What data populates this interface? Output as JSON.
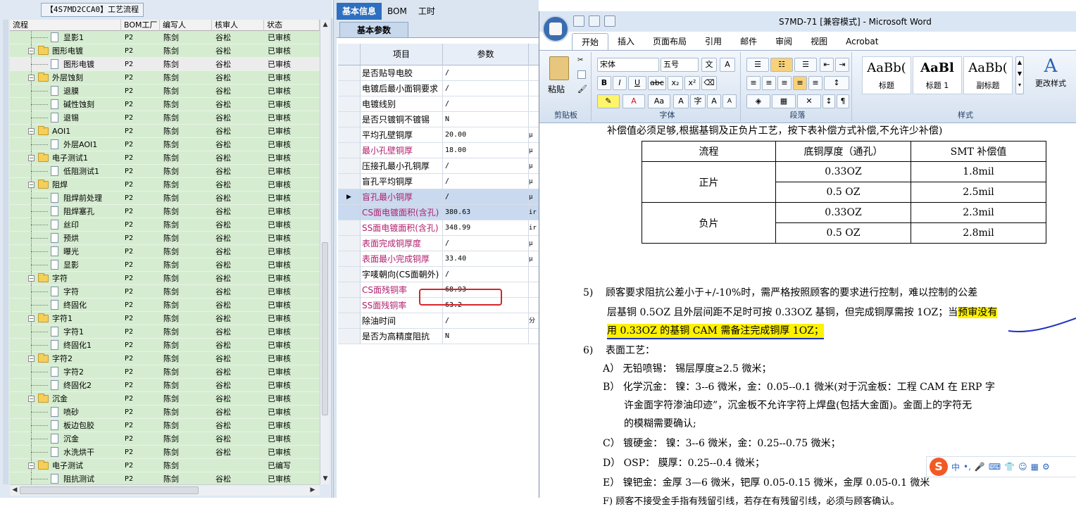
{
  "left_panel": {
    "title": "【4S7MD2CCA0】工艺流程",
    "columns": [
      "流程",
      "BOM工厂",
      "编写人",
      "核审人",
      "状态"
    ],
    "rows": [
      {
        "name": "显影1",
        "type": "doc",
        "level": 2,
        "bom": "P2",
        "writer": "陈剑",
        "reviewer": "谷松",
        "status": "已审核"
      },
      {
        "name": "图形电镀",
        "type": "folder",
        "level": 1,
        "bom": "P2",
        "writer": "陈剑",
        "reviewer": "谷松",
        "status": "已审核"
      },
      {
        "name": "图形电镀",
        "type": "doc",
        "level": 2,
        "bom": "P2",
        "writer": "陈剑",
        "reviewer": "谷松",
        "status": "已审核",
        "selected": true
      },
      {
        "name": "外层蚀刻",
        "type": "folder",
        "level": 1,
        "bom": "P2",
        "writer": "陈剑",
        "reviewer": "谷松",
        "status": "已审核"
      },
      {
        "name": "退膜",
        "type": "doc",
        "level": 2,
        "bom": "P2",
        "writer": "陈剑",
        "reviewer": "谷松",
        "status": "已审核"
      },
      {
        "name": "碱性蚀刻",
        "type": "doc",
        "level": 2,
        "bom": "P2",
        "writer": "陈剑",
        "reviewer": "谷松",
        "status": "已审核"
      },
      {
        "name": "退锡",
        "type": "doc",
        "level": 2,
        "bom": "P2",
        "writer": "陈剑",
        "reviewer": "谷松",
        "status": "已审核"
      },
      {
        "name": "AOI1",
        "type": "folder",
        "level": 1,
        "bom": "P2",
        "writer": "陈剑",
        "reviewer": "谷松",
        "status": "已审核"
      },
      {
        "name": "外层AOI1",
        "type": "doc",
        "level": 2,
        "bom": "P2",
        "writer": "陈剑",
        "reviewer": "谷松",
        "status": "已审核"
      },
      {
        "name": "电子测试1",
        "type": "folder",
        "level": 1,
        "bom": "P2",
        "writer": "陈剑",
        "reviewer": "谷松",
        "status": "已审核"
      },
      {
        "name": "低阻测试1",
        "type": "doc",
        "level": 2,
        "bom": "P2",
        "writer": "陈剑",
        "reviewer": "谷松",
        "status": "已审核"
      },
      {
        "name": "阻焊",
        "type": "folder",
        "level": 1,
        "bom": "P2",
        "writer": "陈剑",
        "reviewer": "谷松",
        "status": "已审核"
      },
      {
        "name": "阻焊前处理",
        "type": "doc",
        "level": 2,
        "bom": "P2",
        "writer": "陈剑",
        "reviewer": "谷松",
        "status": "已审核"
      },
      {
        "name": "阻焊塞孔",
        "type": "doc",
        "level": 2,
        "bom": "P2",
        "writer": "陈剑",
        "reviewer": "谷松",
        "status": "已审核"
      },
      {
        "name": "丝印",
        "type": "doc",
        "level": 2,
        "bom": "P2",
        "writer": "陈剑",
        "reviewer": "谷松",
        "status": "已审核"
      },
      {
        "name": "预烘",
        "type": "doc",
        "level": 2,
        "bom": "P2",
        "writer": "陈剑",
        "reviewer": "谷松",
        "status": "已审核"
      },
      {
        "name": "曝光",
        "type": "doc",
        "level": 2,
        "bom": "P2",
        "writer": "陈剑",
        "reviewer": "谷松",
        "status": "已审核"
      },
      {
        "name": "显影",
        "type": "doc",
        "level": 2,
        "bom": "P2",
        "writer": "陈剑",
        "reviewer": "谷松",
        "status": "已审核"
      },
      {
        "name": "字符",
        "type": "folder",
        "level": 1,
        "bom": "P2",
        "writer": "陈剑",
        "reviewer": "谷松",
        "status": "已审核"
      },
      {
        "name": "字符",
        "type": "doc",
        "level": 2,
        "bom": "P2",
        "writer": "陈剑",
        "reviewer": "谷松",
        "status": "已审核"
      },
      {
        "name": "终固化",
        "type": "doc",
        "level": 2,
        "bom": "P2",
        "writer": "陈剑",
        "reviewer": "谷松",
        "status": "已审核"
      },
      {
        "name": "字符1",
        "type": "folder",
        "level": 1,
        "bom": "P2",
        "writer": "陈剑",
        "reviewer": "谷松",
        "status": "已审核"
      },
      {
        "name": "字符1",
        "type": "doc",
        "level": 2,
        "bom": "P2",
        "writer": "陈剑",
        "reviewer": "谷松",
        "status": "已审核"
      },
      {
        "name": "终固化1",
        "type": "doc",
        "level": 2,
        "bom": "P2",
        "writer": "陈剑",
        "reviewer": "谷松",
        "status": "已审核"
      },
      {
        "name": "字符2",
        "type": "folder",
        "level": 1,
        "bom": "P2",
        "writer": "陈剑",
        "reviewer": "谷松",
        "status": "已审核"
      },
      {
        "name": "字符2",
        "type": "doc",
        "level": 2,
        "bom": "P2",
        "writer": "陈剑",
        "reviewer": "谷松",
        "status": "已审核"
      },
      {
        "name": "终固化2",
        "type": "doc",
        "level": 2,
        "bom": "P2",
        "writer": "陈剑",
        "reviewer": "谷松",
        "status": "已审核"
      },
      {
        "name": "沉金",
        "type": "folder",
        "level": 1,
        "bom": "P2",
        "writer": "陈剑",
        "reviewer": "谷松",
        "status": "已审核"
      },
      {
        "name": "喷砂",
        "type": "doc",
        "level": 2,
        "bom": "P2",
        "writer": "陈剑",
        "reviewer": "谷松",
        "status": "已审核"
      },
      {
        "name": "板边包胶",
        "type": "doc",
        "level": 2,
        "bom": "P2",
        "writer": "陈剑",
        "reviewer": "谷松",
        "status": "已审核"
      },
      {
        "name": "沉金",
        "type": "doc",
        "level": 2,
        "bom": "P2",
        "writer": "陈剑",
        "reviewer": "谷松",
        "status": "已审核"
      },
      {
        "name": "水洗烘干",
        "type": "doc",
        "level": 2,
        "bom": "P2",
        "writer": "陈剑",
        "reviewer": "谷松",
        "status": "已审核"
      },
      {
        "name": "电子测试",
        "type": "folder",
        "level": 1,
        "bom": "P2",
        "writer": "陈剑",
        "reviewer": "",
        "status": "已编写"
      },
      {
        "name": "阻抗测试",
        "type": "doc",
        "level": 2,
        "bom": "P2",
        "writer": "陈剑",
        "reviewer": "谷松",
        "status": "已审核"
      }
    ]
  },
  "middle_panel": {
    "tabs": [
      "基本信息",
      "BOM",
      "工时"
    ],
    "active_tab": "基本信息",
    "subtab": "基本参数",
    "columns": [
      "项目",
      "参数"
    ],
    "rows": [
      {
        "key": "是否贴导电胶",
        "value": "/",
        "unit": "",
        "pink": false
      },
      {
        "key": "电镀后最小面铜要求",
        "value": "/",
        "unit": "",
        "pink": false
      },
      {
        "key": "电镀线别",
        "value": "/",
        "unit": "",
        "pink": false
      },
      {
        "key": "是否只镀铜不镀锡",
        "value": "N",
        "unit": "",
        "pink": false
      },
      {
        "key": "平均孔壁铜厚",
        "value": "20.00",
        "unit": "μ",
        "pink": false
      },
      {
        "key": "最小孔壁铜厚",
        "value": "18.00",
        "unit": "μ",
        "pink": true
      },
      {
        "key": "压接孔最小孔铜厚",
        "value": "/",
        "unit": "μ",
        "pink": false
      },
      {
        "key": "盲孔平均铜厚",
        "value": "/",
        "unit": "μ",
        "pink": false
      },
      {
        "key": "盲孔最小铜厚",
        "value": "/",
        "unit": "μ",
        "pink": true,
        "current": true
      },
      {
        "key": "CS面电镀面积(含孔)",
        "value": "380.63",
        "unit": "ir",
        "pink": true,
        "current": true
      },
      {
        "key": "SS面电镀面积(含孔)",
        "value": "348.99",
        "unit": "ir",
        "pink": true
      },
      {
        "key": "表面完成铜厚度",
        "value": "/",
        "unit": "μ",
        "pink": true
      },
      {
        "key": "表面最小完成铜厚",
        "value": "33.40",
        "unit": "μ",
        "pink": true
      },
      {
        "key": "字唛朝向(CS面朝外)",
        "value": "/",
        "unit": "",
        "pink": false
      },
      {
        "key": "CS面残铜率",
        "value": "68.93",
        "unit": "",
        "pink": true
      },
      {
        "key": "SS面残铜率",
        "value": "63.2",
        "unit": "",
        "pink": true
      },
      {
        "key": "除油时间",
        "value": "/",
        "unit": "分",
        "pink": false
      },
      {
        "key": "是否为高精度阻抗",
        "value": "N",
        "unit": "",
        "pink": false
      }
    ]
  },
  "word": {
    "title": "S7MD-71 [兼容模式] - Microsoft Word",
    "tabs": [
      "开始",
      "插入",
      "页面布局",
      "引用",
      "邮件",
      "审阅",
      "视图",
      "Acrobat"
    ],
    "active_tab": "开始",
    "ribbon": {
      "paste": "粘贴",
      "clipboard": "剪贴板",
      "font_name": "宋体",
      "font_size": "五号",
      "font_group": "字体",
      "paragraph_group": "段落",
      "styles_group": "样式",
      "styles": [
        {
          "preview": "AaBb(",
          "name": "标题"
        },
        {
          "preview": "AaBl",
          "name": "标题 1"
        },
        {
          "preview": "AaBb(",
          "name": "副标题"
        }
      ],
      "change_styles": "更改样式",
      "bold": "B",
      "italic": "I",
      "underline": "U",
      "strike": "abc",
      "sub": "x₂",
      "sup": "x²",
      "grow": "A",
      "shrink": "A",
      "char_scale": "Aa"
    },
    "doc": {
      "line1": "补偿值必须足够,根据基铜及正负片工艺，按下表补偿方式补偿,不允许少补偿)",
      "table": {
        "headers": [
          "流程",
          "底铜厚度（通孔）",
          "SMT 补偿值"
        ],
        "rows": [
          {
            "group": "正片",
            "values": [
              [
                "0.33OZ",
                "1.8mil"
              ],
              [
                "0.5 OZ",
                "2.5mil"
              ]
            ]
          },
          {
            "group": "负片",
            "values": [
              [
                "0.33OZ",
                "2.3mil"
              ],
              [
                "0.5 OZ",
                "2.8mil"
              ]
            ]
          }
        ]
      },
      "p5_num": "5)",
      "p5_a": "顾客要求阻抗公差小于+/-10%时，需严格按照顾客的要求进行控制，难以控制的公差",
      "p5_b1": "层基铜 0.5OZ 且外层间距不足时可按 0.33OZ 基铜，但完成铜厚需按 1OZ；当",
      "p5_b2": "预审没有",
      "p5_c": "用 0.33OZ 的基铜 CAM 需备注完成铜厚 1OZ；",
      "p6_num": "6)",
      "p6": "表面工艺：",
      "a": "A） 无铅喷锡：  锡层厚度≥2.5 微米；",
      "b1": "B） 化学沉金：  镍：3--6 微米，金：0.05--0.1 微米(对于沉金板：工程 CAM 在 ERP 字",
      "b2": "许金面字符渗油印迹”，沉金板不允许字符上焊盘(包括大金面)。金面上的字符无",
      "b3": "的模糊需要确认;",
      "c": "C） 镀硬金：     镍：3--6 微米，金：0.25--0.75 微米；",
      "d": "D） OSP：         膜厚：0.25--0.4 微米；",
      "e": "E） 镍钯金：金厚 3—6 微米，钯厚 0.05-0.15 微米，金厚 0.05-0.1 微米",
      "f": "F) 顾客不接受金手指有残留引线，若存在有残留引线，必须与顾客确认。"
    },
    "ime": {
      "logo": "S",
      "lang": "中"
    }
  }
}
